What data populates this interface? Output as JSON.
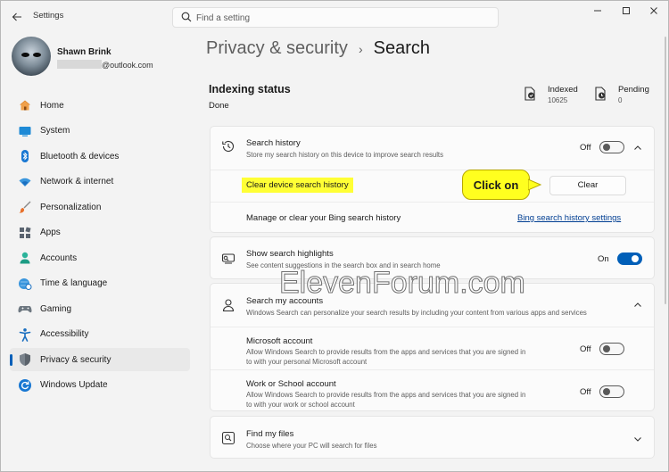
{
  "window": {
    "title": "Settings",
    "search_placeholder": "Find a setting"
  },
  "user": {
    "name": "Shawn Brink",
    "email_domain": "@outlook.com"
  },
  "sidebar": {
    "items": [
      {
        "label": "Home",
        "icon": "home-icon",
        "selected": false
      },
      {
        "label": "System",
        "icon": "system-icon",
        "selected": false
      },
      {
        "label": "Bluetooth & devices",
        "icon": "bluetooth-icon",
        "selected": false
      },
      {
        "label": "Network & internet",
        "icon": "network-icon",
        "selected": false
      },
      {
        "label": "Personalization",
        "icon": "brush-icon",
        "selected": false
      },
      {
        "label": "Apps",
        "icon": "apps-icon",
        "selected": false
      },
      {
        "label": "Accounts",
        "icon": "accounts-icon",
        "selected": false
      },
      {
        "label": "Time & language",
        "icon": "globe-clock-icon",
        "selected": false
      },
      {
        "label": "Gaming",
        "icon": "gamepad-icon",
        "selected": false
      },
      {
        "label": "Accessibility",
        "icon": "accessibility-icon",
        "selected": false
      },
      {
        "label": "Privacy & security",
        "icon": "shield-icon",
        "selected": true
      },
      {
        "label": "Windows Update",
        "icon": "update-icon",
        "selected": false
      }
    ]
  },
  "breadcrumb": {
    "parent": "Privacy & security",
    "separator": "›",
    "current": "Search"
  },
  "indexing": {
    "title": "Indexing status",
    "state": "Done",
    "indexed_label": "Indexed",
    "indexed_value": "10625",
    "pending_label": "Pending",
    "pending_value": "0"
  },
  "search_history": {
    "title": "Search history",
    "description": "Store my search history on this device to improve search results",
    "toggle_state": "Off",
    "clear_label": "Clear device search history",
    "clear_button": "Clear",
    "bing_label": "Manage or clear your Bing search history",
    "bing_link": "Bing search history settings"
  },
  "highlights": {
    "title": "Show search highlights",
    "description": "See content suggestions in the search box and in search home",
    "toggle_state": "On"
  },
  "search_accounts": {
    "title": "Search my accounts",
    "description": "Windows Search can personalize your search results by including your content from various apps and services",
    "microsoft": {
      "title": "Microsoft account",
      "description_line1": "Allow Windows Search to provide results from the apps and services that you are signed in",
      "description_line2": "to with your personal Microsoft account",
      "toggle_state": "Off"
    },
    "work": {
      "title": "Work or School account",
      "description_line1": "Allow Windows Search to provide results from the apps and services that you are signed in",
      "description_line2": "to with your work or school account",
      "toggle_state": "Off"
    }
  },
  "find_files": {
    "title": "Find my files",
    "description": "Choose where your PC will search for files"
  },
  "callout": {
    "text": "Click on"
  },
  "watermark": {
    "text": "ElevenForum.com"
  },
  "colors": {
    "accent": "#005fb8",
    "highlight": "#ffff35",
    "link": "#003e92"
  }
}
